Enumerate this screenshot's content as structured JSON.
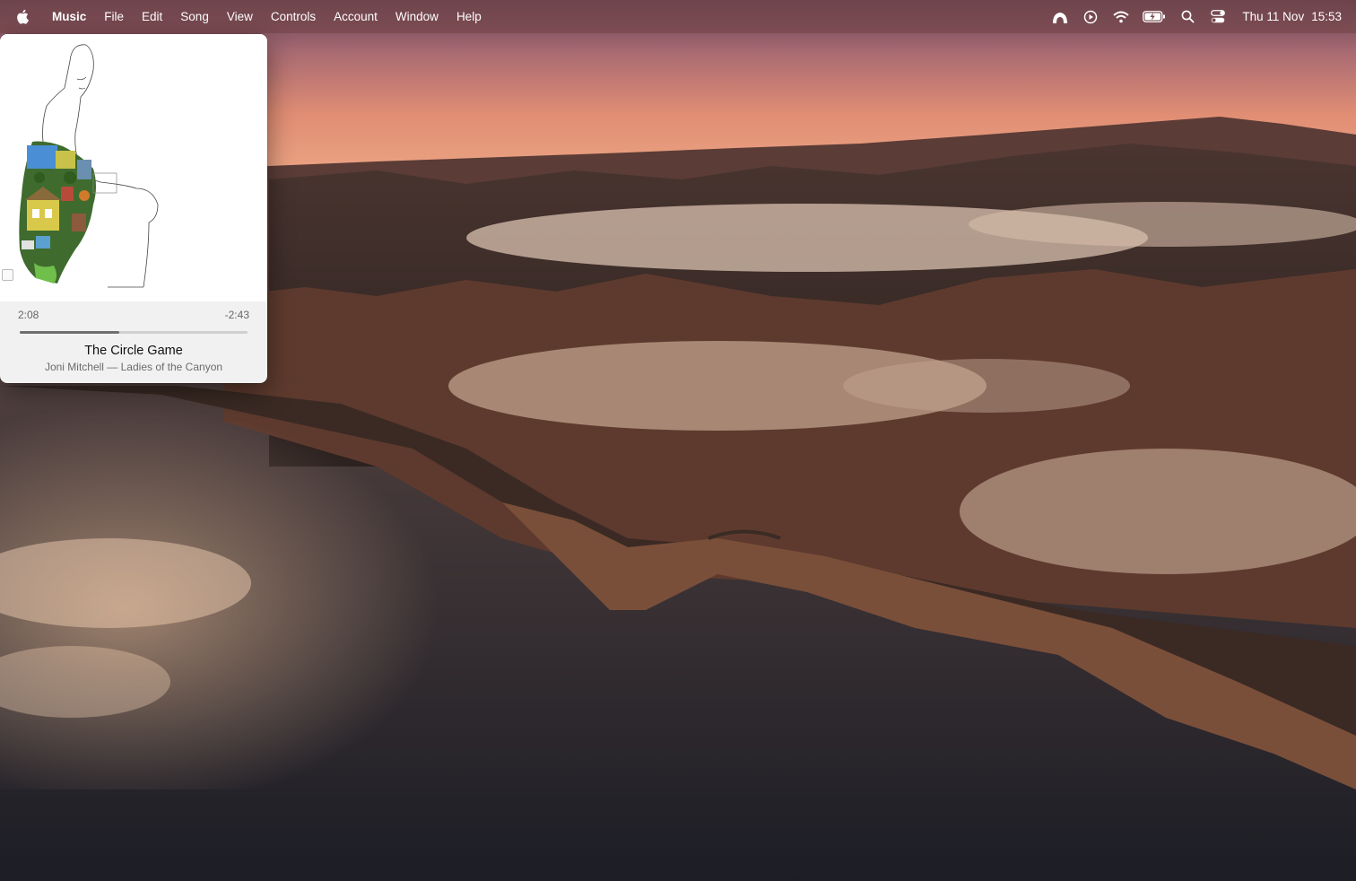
{
  "menubar": {
    "apple_icon": "apple-logo-icon",
    "app_name": "Music",
    "items": [
      "File",
      "Edit",
      "Song",
      "View",
      "Controls",
      "Account",
      "Window",
      "Help"
    ],
    "status_icons": [
      "cloud-app-icon",
      "play-circle-icon",
      "wifi-icon",
      "battery-charging-icon",
      "search-icon",
      "control-center-icon"
    ],
    "date": "Thu 11 Nov",
    "time": "15:53"
  },
  "miniplayer": {
    "elapsed": "2:08",
    "remaining": "-2:43",
    "progress_fraction": 0.437,
    "title": "The Circle Game",
    "subtitle": "Joni Mitchell — Ladies of the Canyon",
    "artwork_icon": "album-artwork"
  },
  "colors": {
    "menubar_bg": "#784646",
    "progress_fill": "#6f6f6f",
    "progress_track": "#cfcfcf"
  }
}
